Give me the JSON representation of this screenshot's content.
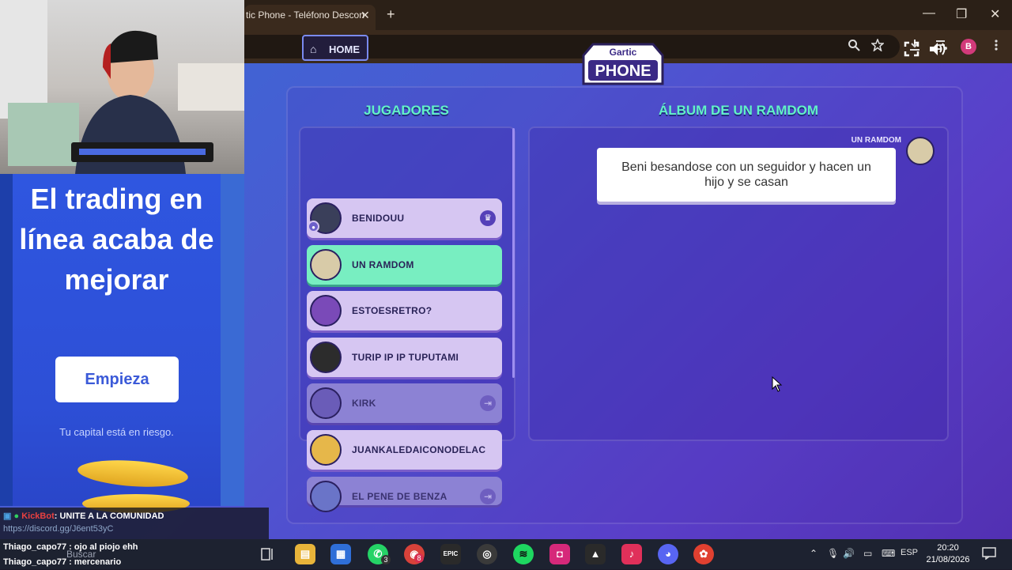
{
  "browser": {
    "tab_title": "tic Phone - Teléfono Descon",
    "tab_close": "✕",
    "new_tab": "+",
    "profile_initial": "B",
    "controls": {
      "minimize": "—",
      "maximize": "❐",
      "close": "✕"
    }
  },
  "game": {
    "home_label": "HOME",
    "logo_top": "Gartic",
    "logo_main": "PHONE",
    "players_heading": "JUGADORES",
    "album_heading": "ÁLBUM DE UN RAMDOM",
    "players": [
      {
        "name": "BENIDOUU",
        "status": "host",
        "avatar_color": "#3a3f5a"
      },
      {
        "name": "UN RAMDOM",
        "status": "active",
        "avatar_color": "#d8cba8"
      },
      {
        "name": "ESTOESRETRO?",
        "status": "normal",
        "avatar_color": "#7a4ab8"
      },
      {
        "name": "TURIP IP IP TUPUTAMI",
        "status": "normal",
        "avatar_color": "#2c2c2c"
      },
      {
        "name": "KIRK",
        "status": "left",
        "avatar_color": "#6a5cb8"
      },
      {
        "name": "JUANKALEDAICONODELAC",
        "status": "normal",
        "avatar_color": "#e6b74a"
      },
      {
        "name": "EL PENE DE BENZA",
        "status": "left",
        "avatar_color": "#6a74c8"
      }
    ],
    "album": {
      "author": "UN RAMDOM",
      "message": "Beni besandose con un seguidor y hacen un hijo y se casan"
    }
  },
  "ad": {
    "title": "El trading en línea acaba de mejorar",
    "button": "Empieza",
    "risk": "Tu capital está en riesgo."
  },
  "chat": {
    "bot_name": "KickBot",
    "bot_message": ": UNITE A LA COMUNIDAD",
    "link": "https://discord.gg/J6ent53yC",
    "msg1_user": "Thiago_capo77",
    "msg1_text": " : ojo al piojo ehh",
    "msg2_user": "Thiago_capo77",
    "msg2_text": " : mercenario"
  },
  "taskbar": {
    "search": "Buscar",
    "lang": "ESP",
    "time": "20:20",
    "date": "21/08/2026",
    "whatsapp_badge": "3",
    "chrome_badge": "8"
  }
}
